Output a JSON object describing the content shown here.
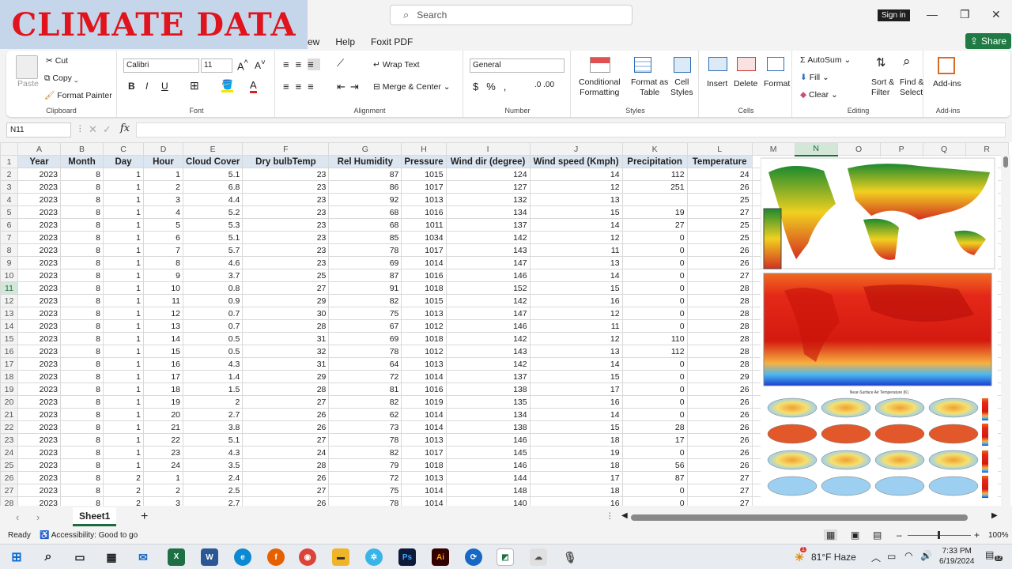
{
  "banner": {
    "title": "CLIMATE DATA"
  },
  "search": {
    "placeholder": "Search"
  },
  "account": {
    "signin": "Sign in"
  },
  "menu": [
    "ew",
    "Help",
    "Foxit PDF"
  ],
  "share": {
    "label": "Share"
  },
  "ribbon": {
    "clipboard": {
      "paste": "Paste",
      "cut": "Cut",
      "copy": "Copy",
      "format_painter": "Format Painter",
      "label": "Clipboard"
    },
    "font": {
      "name": "Calibri",
      "size": "11",
      "label": "Font"
    },
    "alignment": {
      "wrap": "Wrap Text",
      "merge": "Merge & Center",
      "label": "Alignment"
    },
    "number": {
      "format": "General",
      "label": "Number"
    },
    "styles": {
      "conditional": [
        "Conditional",
        "Formatting"
      ],
      "format_table": [
        "Format as",
        "Table"
      ],
      "cell_styles": [
        "Cell",
        "Styles"
      ],
      "label": "Styles"
    },
    "cells": {
      "insert": "Insert",
      "delete": "Delete",
      "format": "Format",
      "label": "Cells"
    },
    "editing": {
      "autosum": "AutoSum",
      "fill": "Fill",
      "clear": "Clear",
      "sort": [
        "Sort &",
        "Filter"
      ],
      "find": [
        "Find &",
        "Select"
      ],
      "label": "Editing"
    },
    "addins": {
      "label": "Add-ins",
      "btn": "Add-ins"
    }
  },
  "formula": {
    "namebox": "N11",
    "fx": "fx",
    "value": ""
  },
  "columns": [
    "A",
    "B",
    "C",
    "D",
    "E",
    "F",
    "G",
    "H",
    "I",
    "J",
    "K",
    "L",
    "M",
    "N",
    "O",
    "P",
    "Q",
    "R"
  ],
  "selected": {
    "col": "N",
    "row": 11
  },
  "headers": [
    "Year",
    "Month",
    "Day",
    "Hour",
    "Cloud Cover",
    "Dry bulbTemp",
    "Rel Humidity",
    "Pressure",
    "Wind dir (degree)",
    "Wind speed (Kmph)",
    "Precipitation",
    "Temperature"
  ],
  "rows": [
    [
      "2023",
      "8",
      "1",
      "1",
      "5.1",
      "23",
      "87",
      "1015",
      "124",
      "14",
      "112",
      "24"
    ],
    [
      "2023",
      "8",
      "1",
      "2",
      "6.8",
      "23",
      "86",
      "1017",
      "127",
      "12",
      "251",
      "26"
    ],
    [
      "2023",
      "8",
      "1",
      "3",
      "4.4",
      "23",
      "92",
      "1013",
      "132",
      "13",
      "",
      "25"
    ],
    [
      "2023",
      "8",
      "1",
      "4",
      "5.2",
      "23",
      "68",
      "1016",
      "134",
      "15",
      "19",
      "27"
    ],
    [
      "2023",
      "8",
      "1",
      "5",
      "5.3",
      "23",
      "68",
      "1011",
      "137",
      "14",
      "27",
      "25"
    ],
    [
      "2023",
      "8",
      "1",
      "6",
      "5.1",
      "23",
      "85",
      "1034",
      "142",
      "12",
      "0",
      "25"
    ],
    [
      "2023",
      "8",
      "1",
      "7",
      "5.7",
      "23",
      "78",
      "1017",
      "143",
      "11",
      "0",
      "26"
    ],
    [
      "2023",
      "8",
      "1",
      "8",
      "4.6",
      "23",
      "69",
      "1014",
      "147",
      "13",
      "0",
      "26"
    ],
    [
      "2023",
      "8",
      "1",
      "9",
      "3.7",
      "25",
      "87",
      "1016",
      "146",
      "14",
      "0",
      "27"
    ],
    [
      "2023",
      "8",
      "1",
      "10",
      "0.8",
      "27",
      "91",
      "1018",
      "152",
      "15",
      "0",
      "28"
    ],
    [
      "2023",
      "8",
      "1",
      "11",
      "0.9",
      "29",
      "82",
      "1015",
      "142",
      "16",
      "0",
      "28"
    ],
    [
      "2023",
      "8",
      "1",
      "12",
      "0.7",
      "30",
      "75",
      "1013",
      "147",
      "12",
      "0",
      "28"
    ],
    [
      "2023",
      "8",
      "1",
      "13",
      "0.7",
      "28",
      "67",
      "1012",
      "146",
      "11",
      "0",
      "28"
    ],
    [
      "2023",
      "8",
      "1",
      "14",
      "0.5",
      "31",
      "69",
      "1018",
      "142",
      "12",
      "110",
      "28"
    ],
    [
      "2023",
      "8",
      "1",
      "15",
      "0.5",
      "32",
      "78",
      "1012",
      "143",
      "13",
      "112",
      "28"
    ],
    [
      "2023",
      "8",
      "1",
      "16",
      "4.3",
      "31",
      "64",
      "1013",
      "142",
      "14",
      "0",
      "28"
    ],
    [
      "2023",
      "8",
      "1",
      "17",
      "1.4",
      "29",
      "72",
      "1014",
      "137",
      "15",
      "0",
      "29"
    ],
    [
      "2023",
      "8",
      "1",
      "18",
      "1.5",
      "28",
      "81",
      "1016",
      "138",
      "17",
      "0",
      "26"
    ],
    [
      "2023",
      "8",
      "1",
      "19",
      "2",
      "27",
      "82",
      "1019",
      "135",
      "16",
      "0",
      "26"
    ],
    [
      "2023",
      "8",
      "1",
      "20",
      "2.7",
      "26",
      "62",
      "1014",
      "134",
      "14",
      "0",
      "26"
    ],
    [
      "2023",
      "8",
      "1",
      "21",
      "3.8",
      "26",
      "73",
      "1014",
      "138",
      "15",
      "28",
      "26"
    ],
    [
      "2023",
      "8",
      "1",
      "22",
      "5.1",
      "27",
      "78",
      "1013",
      "146",
      "18",
      "17",
      "26"
    ],
    [
      "2023",
      "8",
      "1",
      "23",
      "4.3",
      "24",
      "82",
      "1017",
      "145",
      "19",
      "0",
      "26"
    ],
    [
      "2023",
      "8",
      "1",
      "24",
      "3.5",
      "28",
      "79",
      "1018",
      "146",
      "18",
      "56",
      "26"
    ],
    [
      "2023",
      "8",
      "2",
      "1",
      "2.4",
      "26",
      "72",
      "1013",
      "144",
      "17",
      "87",
      "27"
    ],
    [
      "2023",
      "8",
      "2",
      "2",
      "2.5",
      "27",
      "75",
      "1014",
      "148",
      "18",
      "0",
      "27"
    ],
    [
      "2023",
      "8",
      "2",
      "3",
      "2.7",
      "26",
      "78",
      "1014",
      "140",
      "16",
      "0",
      "27"
    ]
  ],
  "images": {
    "chart_title": "Near-Surface Air Temperature (K)"
  },
  "sheets": {
    "active": "Sheet1",
    "add": "+"
  },
  "status": {
    "ready": "Ready",
    "accessibility": "Accessibility: Good to go",
    "zoom": "100%"
  },
  "taskbar": {
    "weather": "81°F  Haze",
    "time": "7:33 PM",
    "date": "6/19/2024",
    "notif": "12",
    "weather_badge": "1"
  }
}
